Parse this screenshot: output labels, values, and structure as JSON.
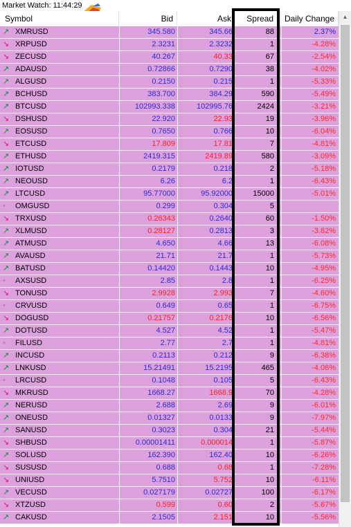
{
  "window": {
    "title": "Market Watch: 11:44:29"
  },
  "columns": {
    "symbol": "Symbol",
    "bid": "Bid",
    "ask": "Ask",
    "spread": "Spread",
    "daily_change": "Daily Change"
  },
  "colors": {
    "row_bg": "#dca1dc",
    "bid_blue": "#2b2bd9",
    "price_red": "#ff2020",
    "change_red": "#ff2a2a",
    "arrow_up": "#0a8a4a",
    "arrow_down": "#e0177a",
    "highlight_border": "#000000"
  },
  "rows": [
    {
      "dir": "up",
      "symbol": "XMRUSD",
      "bid": "345.580",
      "ask": "345.66",
      "price_color": "blue",
      "spread": "88",
      "change": "2.37%",
      "change_color": "pos"
    },
    {
      "dir": "down",
      "symbol": "XRPUSD",
      "bid": "2.3231",
      "ask": "2.3232",
      "price_color": "blue",
      "spread": "1",
      "change": "-4.28%",
      "change_color": "neg"
    },
    {
      "dir": "down",
      "symbol": "ZECUSD",
      "bid": "40.267",
      "ask": "40.33",
      "price_color": "blue",
      "ask_color": "red",
      "spread": "67",
      "change": "-2.54%",
      "change_color": "neg"
    },
    {
      "dir": "up",
      "symbol": "ADAUSD",
      "bid": "0.72866",
      "ask": "0.7290",
      "price_color": "blue",
      "spread": "38",
      "change": "-4.02%",
      "change_color": "neg"
    },
    {
      "dir": "up",
      "symbol": "ALGUSD",
      "bid": "0.2150",
      "ask": "0.215",
      "price_color": "blue",
      "spread": "1",
      "change": "-5.33%",
      "change_color": "neg"
    },
    {
      "dir": "up",
      "symbol": "BCHUSD",
      "bid": "383.700",
      "ask": "384.29",
      "price_color": "blue",
      "spread": "590",
      "change": "-5.49%",
      "change_color": "neg"
    },
    {
      "dir": "up",
      "symbol": "BTCUSD",
      "bid": "102993.338",
      "ask": "102995.76",
      "price_color": "blue",
      "spread": "2424",
      "change": "-3.21%",
      "change_color": "neg"
    },
    {
      "dir": "down",
      "symbol": "DSHUSD",
      "bid": "22.920",
      "ask": "22.93",
      "price_color": "blue",
      "ask_color": "red",
      "spread": "19",
      "change": "-3.96%",
      "change_color": "neg"
    },
    {
      "dir": "up",
      "symbol": "EOSUSD",
      "bid": "0.7650",
      "ask": "0.766",
      "price_color": "blue",
      "spread": "10",
      "change": "-6.04%",
      "change_color": "neg"
    },
    {
      "dir": "down",
      "symbol": "ETCUSD",
      "bid": "17.809",
      "ask": "17.81",
      "price_color": "red",
      "spread": "7",
      "change": "-4.81%",
      "change_color": "neg"
    },
    {
      "dir": "up",
      "symbol": "ETHUSD",
      "bid": "2419.315",
      "ask": "2419.89",
      "price_color": "blue",
      "ask_color": "red",
      "spread": "580",
      "change": "-3.09%",
      "change_color": "neg"
    },
    {
      "dir": "up",
      "symbol": "IOTUSD",
      "bid": "0.2179",
      "ask": "0.218",
      "price_color": "blue",
      "spread": "2",
      "change": "-5.18%",
      "change_color": "neg"
    },
    {
      "dir": "up",
      "symbol": "NEOUSD",
      "bid": "6.26",
      "ask": "6.2",
      "price_color": "blue",
      "spread": "1",
      "change": "-6.43%",
      "change_color": "neg"
    },
    {
      "dir": "up",
      "symbol": "LTCUSD",
      "bid": "95.77000",
      "ask": "95.92000",
      "price_color": "blue",
      "spread": "15000",
      "change": "-5.01%",
      "change_color": "neg"
    },
    {
      "dir": "flat",
      "symbol": "OMGUSD",
      "bid": "0.299",
      "ask": "0.304",
      "price_color": "blue",
      "spread": "5",
      "change": "",
      "change_color": "neg"
    },
    {
      "dir": "down",
      "symbol": "TRXUSD",
      "bid": "0.26343",
      "ask": "0.2640",
      "price_color": "red",
      "ask_color": "blue",
      "spread": "60",
      "change": "-1.50%",
      "change_color": "neg"
    },
    {
      "dir": "up",
      "symbol": "XLMUSD",
      "bid": "0.28127",
      "ask": "0.2813",
      "price_color": "red",
      "ask_color": "blue",
      "spread": "3",
      "change": "-3.82%",
      "change_color": "neg"
    },
    {
      "dir": "up",
      "symbol": "ATMUSD",
      "bid": "4.650",
      "ask": "4.66",
      "price_color": "blue",
      "spread": "13",
      "change": "-6.08%",
      "change_color": "neg"
    },
    {
      "dir": "up",
      "symbol": "AVAUSD",
      "bid": "21.71",
      "ask": "21.7",
      "price_color": "blue",
      "spread": "1",
      "change": "-5.73%",
      "change_color": "neg"
    },
    {
      "dir": "up",
      "symbol": "BATUSD",
      "bid": "0.14420",
      "ask": "0.1443",
      "price_color": "blue",
      "spread": "10",
      "change": "-4.95%",
      "change_color": "neg"
    },
    {
      "dir": "flat",
      "symbol": "AXSUSD",
      "bid": "2.85",
      "ask": "2.8",
      "price_color": "blue",
      "spread": "1",
      "change": "-6.25%",
      "change_color": "neg"
    },
    {
      "dir": "down",
      "symbol": "TONUSD",
      "bid": "2.9928",
      "ask": "2.993",
      "price_color": "red",
      "spread": "7",
      "change": "-4.60%",
      "change_color": "neg"
    },
    {
      "dir": "flat",
      "symbol": "CRVUSD",
      "bid": "0.649",
      "ask": "0.65",
      "price_color": "blue",
      "spread": "1",
      "change": "-6.75%",
      "change_color": "neg"
    },
    {
      "dir": "down",
      "symbol": "DOGUSD",
      "bid": "0.21757",
      "ask": "0.2176",
      "price_color": "red",
      "spread": "10",
      "change": "-6.56%",
      "change_color": "neg"
    },
    {
      "dir": "up",
      "symbol": "DOTUSD",
      "bid": "4.527",
      "ask": "4.52",
      "price_color": "blue",
      "spread": "1",
      "change": "-5.47%",
      "change_color": "neg"
    },
    {
      "dir": "flat",
      "symbol": "FILUSD",
      "bid": "2.77",
      "ask": "2.7",
      "price_color": "blue",
      "spread": "1",
      "change": "-4.81%",
      "change_color": "neg"
    },
    {
      "dir": "up",
      "symbol": "INCUSD",
      "bid": "0.2113",
      "ask": "0.212",
      "price_color": "blue",
      "spread": "9",
      "change": "-6.38%",
      "change_color": "neg"
    },
    {
      "dir": "up",
      "symbol": "LNKUSD",
      "bid": "15.21491",
      "ask": "15.2195",
      "price_color": "blue",
      "spread": "465",
      "change": "-4.06%",
      "change_color": "neg"
    },
    {
      "dir": "flat",
      "symbol": "LRCUSD",
      "bid": "0.1048",
      "ask": "0.105",
      "price_color": "blue",
      "spread": "5",
      "change": "-6.43%",
      "change_color": "neg"
    },
    {
      "dir": "down",
      "symbol": "MKRUSD",
      "bid": "1668.27",
      "ask": "1668.9",
      "price_color": "blue",
      "ask_color": "red",
      "spread": "70",
      "change": "-4.28%",
      "change_color": "neg"
    },
    {
      "dir": "up",
      "symbol": "NERUSD",
      "bid": "2.688",
      "ask": "2.69",
      "price_color": "blue",
      "spread": "9",
      "change": "-6.01%",
      "change_color": "neg"
    },
    {
      "dir": "up",
      "symbol": "ONEUSD",
      "bid": "0.01327",
      "ask": "0.0133",
      "price_color": "blue",
      "spread": "9",
      "change": "-7.97%",
      "change_color": "neg"
    },
    {
      "dir": "up",
      "symbol": "SANUSD",
      "bid": "0.3023",
      "ask": "0.304",
      "price_color": "blue",
      "spread": "21",
      "change": "-5.44%",
      "change_color": "neg"
    },
    {
      "dir": "down",
      "symbol": "SHBUSD",
      "bid": "0.00001411",
      "ask": "0.000014",
      "price_color": "blue",
      "ask_color": "red",
      "spread": "1",
      "change": "-5.87%",
      "change_color": "neg"
    },
    {
      "dir": "up",
      "symbol": "SOLUSD",
      "bid": "162.390",
      "ask": "162.40",
      "price_color": "blue",
      "spread": "10",
      "change": "-6.26%",
      "change_color": "neg"
    },
    {
      "dir": "down",
      "symbol": "SUSUSD",
      "bid": "0.688",
      "ask": "0.68",
      "price_color": "blue",
      "ask_color": "red",
      "spread": "1",
      "change": "-7.28%",
      "change_color": "neg"
    },
    {
      "dir": "down",
      "symbol": "UNIUSD",
      "bid": "5.7510",
      "ask": "5.752",
      "price_color": "blue",
      "ask_color": "red",
      "spread": "10",
      "change": "-6.11%",
      "change_color": "neg"
    },
    {
      "dir": "up",
      "symbol": "VECUSD",
      "bid": "0.027179",
      "ask": "0.02727",
      "price_color": "blue",
      "spread": "100",
      "change": "-6.17%",
      "change_color": "neg"
    },
    {
      "dir": "down",
      "symbol": "XTZUSD",
      "bid": "0.599",
      "ask": "0.60",
      "price_color": "red",
      "spread": "2",
      "change": "-5.67%",
      "change_color": "neg"
    },
    {
      "dir": "up",
      "symbol": "CAKUSD",
      "bid": "2.1505",
      "ask": "2.151",
      "price_color": "blue",
      "ask_color": "red",
      "spread": "10",
      "change": "-5.56%",
      "change_color": "neg"
    }
  ]
}
